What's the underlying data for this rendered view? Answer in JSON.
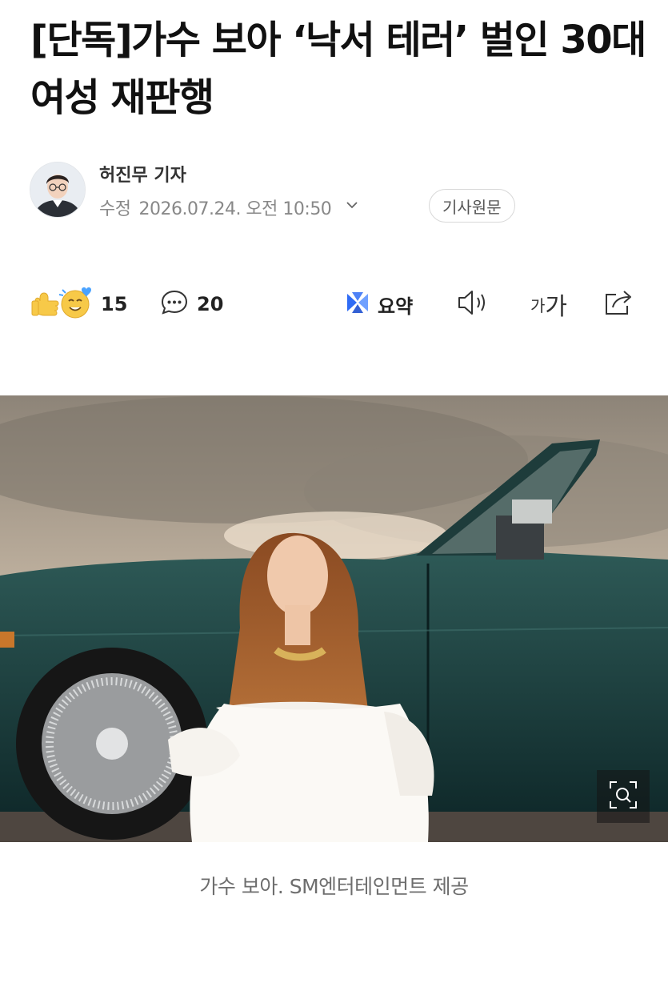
{
  "article": {
    "headline": "[단독]가수 보아 ‘낙서 테러’ 벌인 30대 여성 재판행"
  },
  "byline": {
    "reporter": "허진무 기자",
    "modified_label": "수정",
    "datetime": "2026.07.24. 오전 10:50",
    "original_button": "기사원문"
  },
  "toolbar": {
    "reaction_count": "15",
    "comment_count": "20",
    "summary_label": "요약",
    "font_size_small": "가",
    "font_size_large": "가"
  },
  "photo": {
    "caption": "가수 보아. SM엔터테인먼트 제공"
  },
  "colors": {
    "summary_accent": "#2f6cf5",
    "emoji_yellow": "#f7c948",
    "caption_gray": "#6e6e6e"
  },
  "icons": [
    "reaction-emoji-icon",
    "comment-icon",
    "summary-icon",
    "speaker-icon",
    "font-size-icon",
    "share-icon",
    "zoom-icon",
    "chevron-down-icon"
  ]
}
